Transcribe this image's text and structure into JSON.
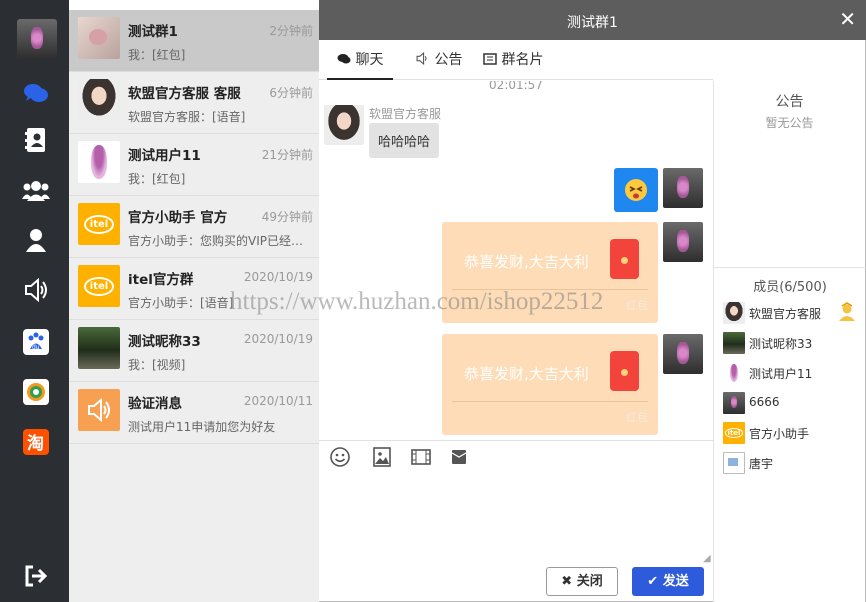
{
  "chat": {
    "title": "测试群1",
    "close_glyph": "✕",
    "tabs": [
      {
        "label": "聊天",
        "icon": "chat-bubbles-icon",
        "active": true
      },
      {
        "label": "公告",
        "icon": "speaker-icon",
        "active": false
      },
      {
        "label": "群名片",
        "icon": "card-icon",
        "active": false
      }
    ],
    "timestamp": "02:01:57",
    "messages": [
      {
        "sender": "软盟官方客服",
        "text": "哈哈哈哈",
        "type": "text",
        "side": "left"
      },
      {
        "type": "emoji",
        "side": "right",
        "emoji": "😝"
      },
      {
        "type": "redpacket",
        "side": "right",
        "text": "恭喜发财,大吉大利",
        "label": "红包"
      },
      {
        "type": "redpacket",
        "side": "right",
        "text": "恭喜发财,大吉大利",
        "label": "红包"
      }
    ],
    "tools": [
      "emoji-icon",
      "image-icon",
      "video-icon",
      "redpacket-icon"
    ],
    "close_label": "关闭",
    "send_label": "发送"
  },
  "conversations": [
    {
      "name": "测试群1",
      "time": "2分钟前",
      "preview": "我：[红包]",
      "active": true
    },
    {
      "name": "软盟官方客服 客服",
      "time": "6分钟前",
      "preview": "软盟官方客服：[语音]",
      "active": false
    },
    {
      "name": "测试用户11",
      "time": "21分钟前",
      "preview": "我：[红包]",
      "active": false
    },
    {
      "name": "官方小助手 官方",
      "time": "49分钟前",
      "preview": "官方小助手：您购买的VIP已经开通",
      "active": false
    },
    {
      "name": "itel官方群",
      "time": "2020/10/19",
      "preview": "官方小助手：[语音]",
      "active": false
    },
    {
      "name": "测试昵称33",
      "time": "2020/10/19",
      "preview": "我：[视频]",
      "active": false
    },
    {
      "name": "验证消息",
      "time": "2020/10/11",
      "preview": "测试用户11申请加您为好友",
      "active": false
    }
  ],
  "sidebar": {
    "notice_title": "公告",
    "notice_body": "暂无公告",
    "members_title": "成员(6/500)",
    "members": [
      {
        "name": "软盟官方客服",
        "badge": "admin-icon"
      },
      {
        "name": "测试昵称33"
      },
      {
        "name": "测试用户11"
      },
      {
        "name": "6666"
      },
      {
        "name": "官方小助手"
      },
      {
        "name": "唐宇"
      }
    ]
  },
  "rail": {
    "icons": [
      "chat-icon",
      "contacts-icon",
      "group-icon",
      "user-icon",
      "speaker-icon",
      "baidu-icon",
      "weibo-icon",
      "taobao-icon",
      "logout-icon"
    ],
    "taobao_text": "淘"
  },
  "watermark": "https://www.huzhan.com/ishop22512",
  "colors": {
    "rail": "#2b2e33",
    "titlebar": "#5d5d5d",
    "send": "#2e5bdb",
    "redpacket": "#fddcb7",
    "accent_blue": "#1e6fe8"
  }
}
